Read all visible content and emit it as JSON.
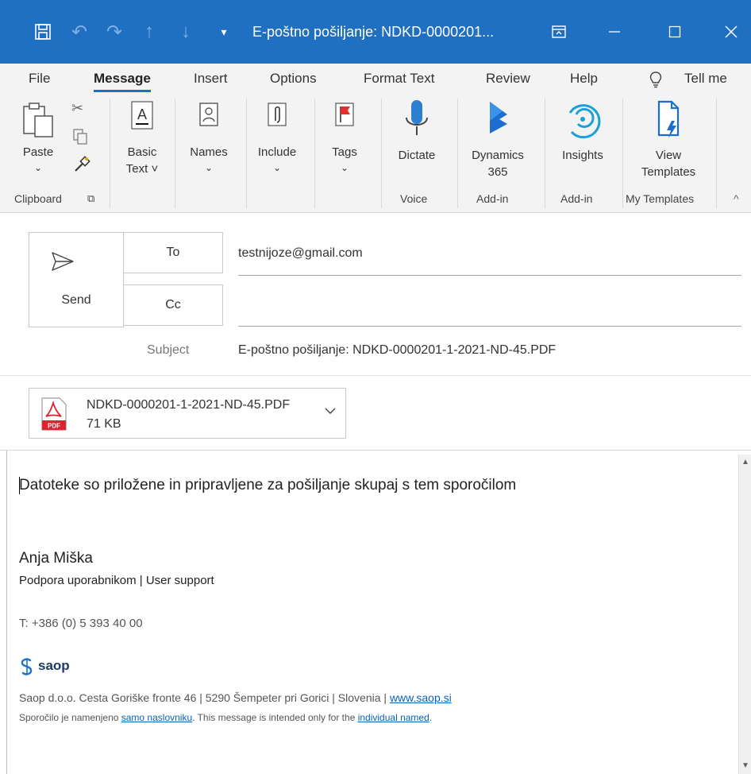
{
  "window": {
    "title": "E-poštno pošiljanje: NDKD-0000201..."
  },
  "tabs": [
    "File",
    "Message",
    "Insert",
    "Options",
    "Format Text",
    "Review",
    "Help",
    "Tell me"
  ],
  "ribbon": {
    "paste": "Paste",
    "basic_text_1": "Basic",
    "basic_text_2": "Text ˅",
    "names": "Names",
    "include": "Include",
    "tags": "Tags",
    "dictate": "Dictate",
    "dynamics_1": "Dynamics",
    "dynamics_2": "365",
    "insights": "Insights",
    "view_templates_1": "View",
    "view_templates_2": "Templates",
    "groups": {
      "clipboard": "Clipboard",
      "voice": "Voice",
      "addin1": "Add-in",
      "addin2": "Add-in",
      "my_templates": "My Templates"
    }
  },
  "compose": {
    "send_label": "Send",
    "to_label": "To",
    "cc_label": "Cc",
    "to_value": "testnijoze@gmail.com",
    "cc_value": "",
    "subject_label": "Subject",
    "subject_value": "E-poštno pošiljanje: NDKD-0000201-1-2021-ND-45.PDF"
  },
  "attachment": {
    "name": "NDKD-0000201-1-2021-ND-45.PDF",
    "size": "71 KB",
    "icon_text": "PDF"
  },
  "body": {
    "line1": "Datoteke so priložene in pripravljene za pošiljanje skupaj s tem sporočilom",
    "sig_name": "Anja Miška",
    "sig_role": "Podpora uporabnikom | User support",
    "sig_phone": "T:  +386 (0) 5 393 40 00",
    "logo_text": "saop",
    "address": "Saop d.o.o. Cesta Goriške fronte 46 | 5290 Šempeter pri Gorici | Slovenia | ",
    "website": "www.saop.si",
    "disclaimer_1": "Sporočilo je namenjeno ",
    "disclaimer_link1": "samo naslovniku",
    "disclaimer_2": ". This message is intended only for the ",
    "disclaimer_link2": "individual named",
    "disclaimer_3": "."
  },
  "colors": {
    "titlebar": "#1f6fc3",
    "link": "#0563c1",
    "pdf_red": "#d9262d"
  }
}
